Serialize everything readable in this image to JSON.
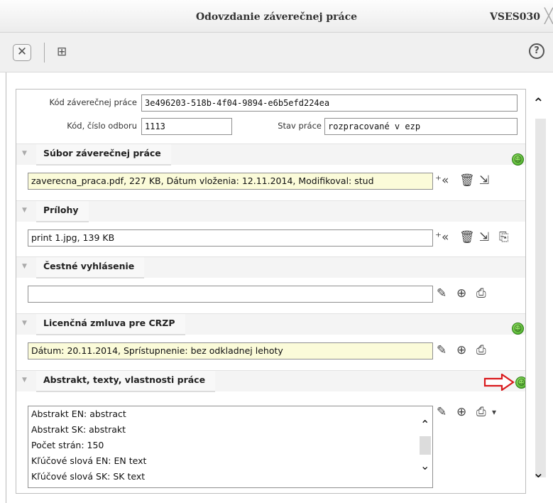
{
  "window": {
    "title": "Odovzdanie záverečnej práce",
    "code": "VSES030",
    "close_glyph": "╳"
  },
  "toolbar": {
    "close_glyph": "✕",
    "tree_glyph": "⊞",
    "help_glyph": "?"
  },
  "form": {
    "kod_prace_label": "Kód záverečnej práce",
    "kod_prace_value": "3e496203-518b-4f04-9894-e6b5efd224ea",
    "kod_odboru_label": "Kód, číslo odboru",
    "kod_odboru_value": "1113",
    "stav_label": "Stav práce",
    "stav_value": "rozpracované v ezp"
  },
  "sections": {
    "subor": {
      "title": "Súbor záverečnej práce",
      "value": "zaverecna_praca.pdf, 227 KB, Dátum vloženia: 12.11.2014, Modifikoval: stud"
    },
    "prilohy": {
      "title": "Prílohy",
      "value": "print 1.jpg, 139 KB"
    },
    "cestne": {
      "title": "Čestné vyhlásenie",
      "value": ""
    },
    "licencna": {
      "title": "Licenčná zmluva pre CRZP",
      "value": "Dátum: 20.11.2014, Sprístupnenie: bez odkladnej lehoty"
    },
    "abstrakt": {
      "title": "Abstrakt, texty, vlastnosti práce",
      "lines": [
        "Abstrakt EN: abstract",
        "Abstrakt SK: abstrakt",
        "Počet strán: 150",
        "Kľúčové slová EN: EN text",
        "Kľúčové slová SK: SK text"
      ]
    }
  },
  "colors": {
    "highlight_field": "#fbfbd9",
    "status_ok": "#3ea01f",
    "arrow": "#d9191c"
  },
  "icons": {
    "add_glyph": "⁺«",
    "delete_glyph": "🗑",
    "open_glyph": "⇲",
    "newfile_glyph": "⎘",
    "edit_glyph": "✎",
    "zoom_glyph": "⊕",
    "print_glyph": "⎙",
    "dropdown_glyph": "▾",
    "smile_glyph": "☺",
    "collapse_glyph": "▼",
    "scroll_up_glyph": "⌃",
    "scroll_down_glyph": "⌄"
  }
}
